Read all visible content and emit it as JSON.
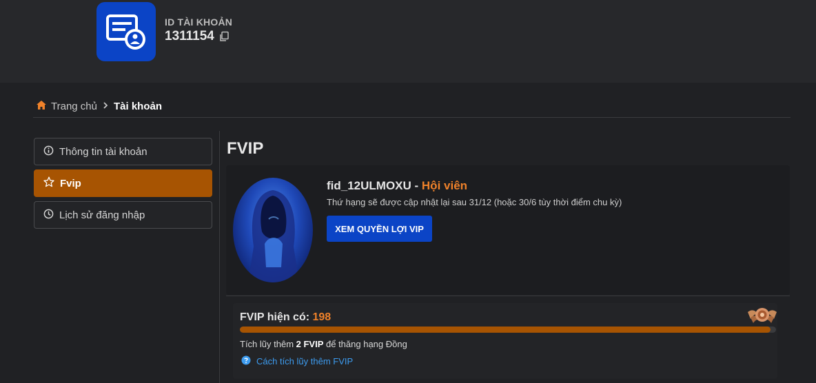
{
  "account": {
    "id_label": "ID TÀI KHOẢN",
    "id_value": "1311154",
    "icon": "account-card-icon",
    "copy_icon": "copy-icon"
  },
  "breadcrumb": {
    "home_label": "Trang chủ",
    "current_label": "Tài khoản"
  },
  "sidebar": {
    "items": [
      {
        "label": "Thông tin tài khoản",
        "icon": "info-icon",
        "active": false
      },
      {
        "label": "Fvip",
        "icon": "star-icon",
        "active": true
      },
      {
        "label": "Lịch sử đăng nhập",
        "icon": "clock-icon",
        "active": false
      }
    ]
  },
  "main": {
    "title": "FVIP",
    "username": "fid_12ULMOXU",
    "separator": " - ",
    "rank": "Hội viên",
    "rank_note": "Thứ hạng sẽ được cập nhật lại sau 31/12 (hoặc 30/6 tùy thời điểm chu kỳ)",
    "vip_button": "XEM QUYỀN LỢI VIP",
    "points_label": "FVIP hiện có: ",
    "points_value": "198",
    "progress_fraction": 0.99,
    "accum_prefix": "Tích lũy thêm ",
    "accum_amount": "2 FVIP",
    "accum_suffix": " để thăng hạng Đồng",
    "howto_link": "Cách tích lũy thêm FVIP",
    "badge_icon": "bronze-rank-badge-icon"
  },
  "colors": {
    "accent_orange": "#a75402",
    "rank_orange": "#f0822a",
    "brand_blue": "#0b44c6",
    "link_blue": "#3d9cf0"
  }
}
